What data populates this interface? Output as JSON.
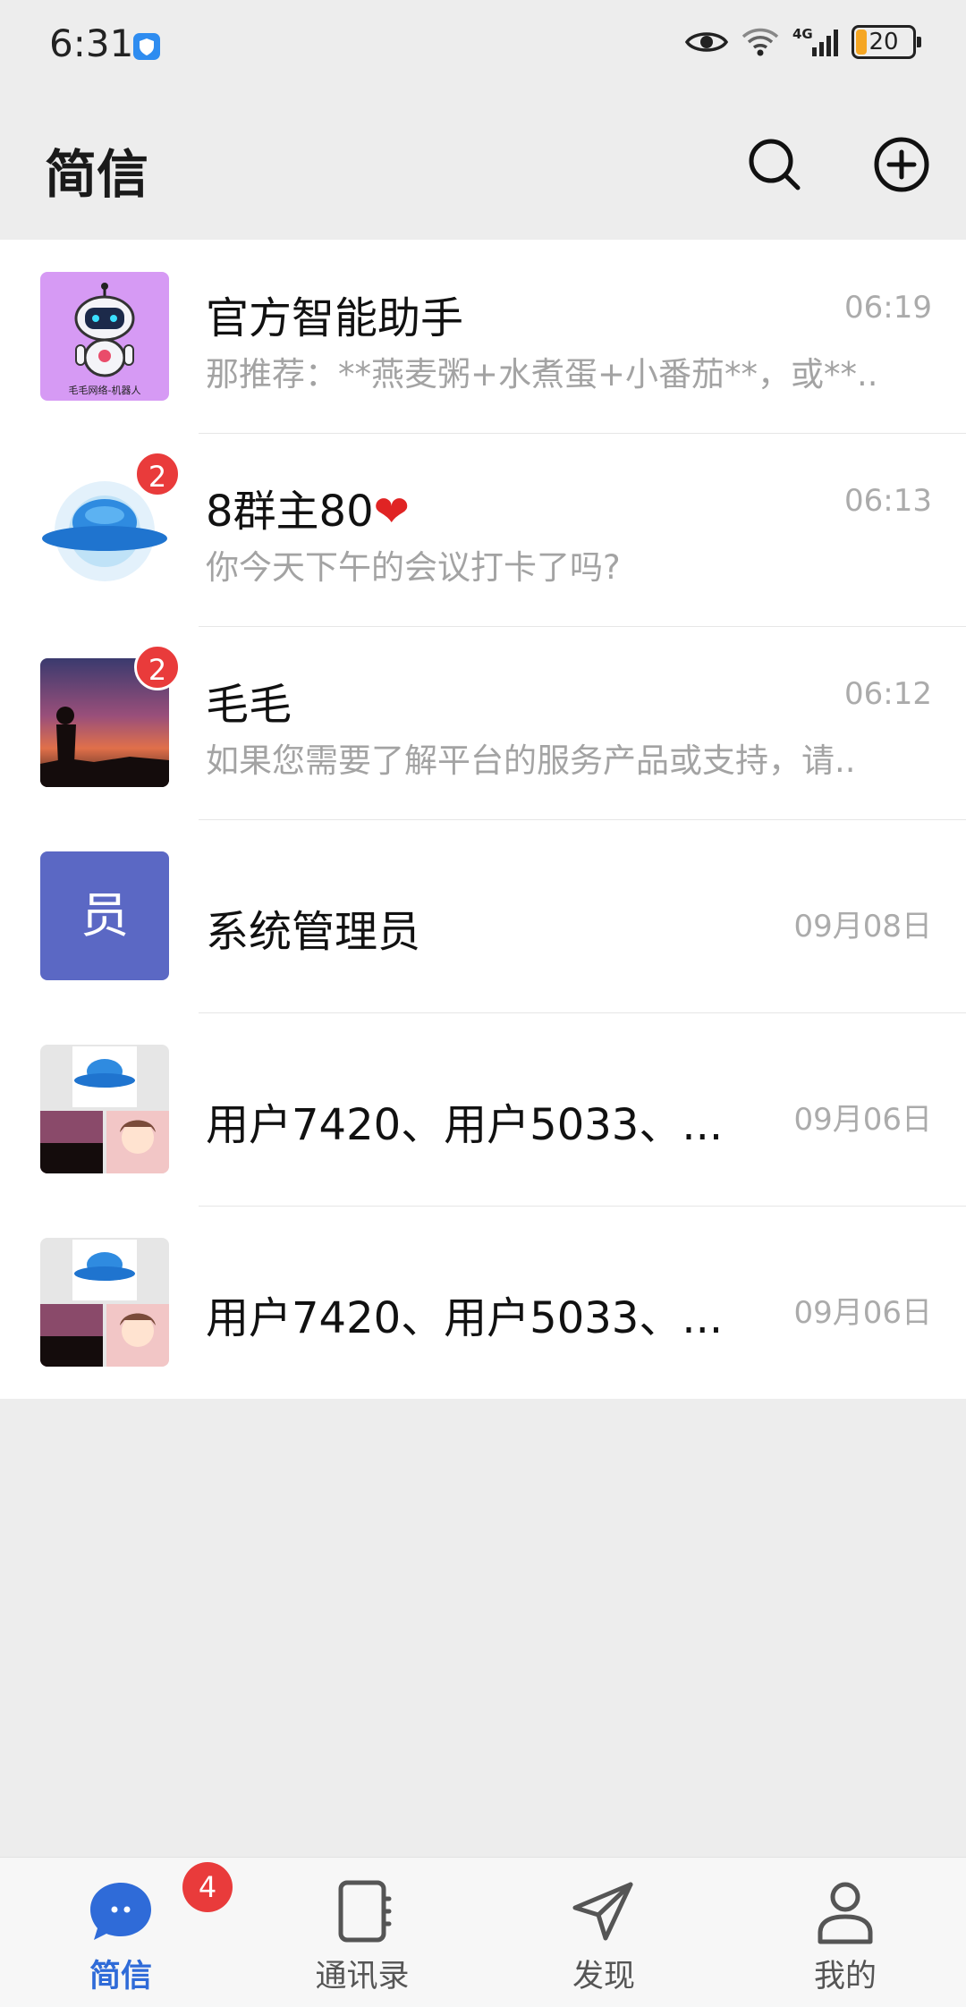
{
  "status_bar": {
    "time": "6:31",
    "battery": "20",
    "battery_level": 0.2,
    "network": "4G",
    "icons": [
      "shield-icon",
      "eye-icon",
      "wifi-icon",
      "signal-icon",
      "battery-icon"
    ]
  },
  "header": {
    "title": "简信",
    "search_icon": "search-icon",
    "add_icon": "plus-circle-icon"
  },
  "conversations": [
    {
      "name": "官方智能助手",
      "message": "那推荐：**燕麦粥+水煮蛋+小番茄**，或**..",
      "time": "06:19",
      "badge": "",
      "avatar_caption": "毛毛网络-机器人"
    },
    {
      "name": "8群主80",
      "name_emoji": "❤",
      "message": "你今天下午的会议打卡了吗?",
      "time": "06:13",
      "badge": "2"
    },
    {
      "name": "毛毛",
      "message": "如果您需要了解平台的服务产品或支持，请..",
      "time": "06:12",
      "badge": "2"
    },
    {
      "name": "系统管理员",
      "message": "",
      "time": "09月08日",
      "badge": "",
      "avatar_text": "员"
    },
    {
      "name": "用户7420、用户5033、...",
      "message": "",
      "time": "09月06日",
      "badge": ""
    },
    {
      "name": "用户7420、用户5033、...",
      "message": "",
      "time": "09月06日",
      "badge": ""
    }
  ],
  "bottom_nav": {
    "items": [
      {
        "label": "简信",
        "icon": "chat-bubble-icon",
        "active": true
      },
      {
        "label": "通讯录",
        "icon": "contacts-book-icon",
        "active": false
      },
      {
        "label": "发现",
        "icon": "paper-plane-icon",
        "active": false
      },
      {
        "label": "我的",
        "icon": "person-icon",
        "active": false
      }
    ],
    "badge": "4"
  },
  "colors": {
    "accent": "#2f6bd8",
    "badge": "#e93b3b",
    "background": "#ededed",
    "admin_avatar": "#5b68c4"
  }
}
